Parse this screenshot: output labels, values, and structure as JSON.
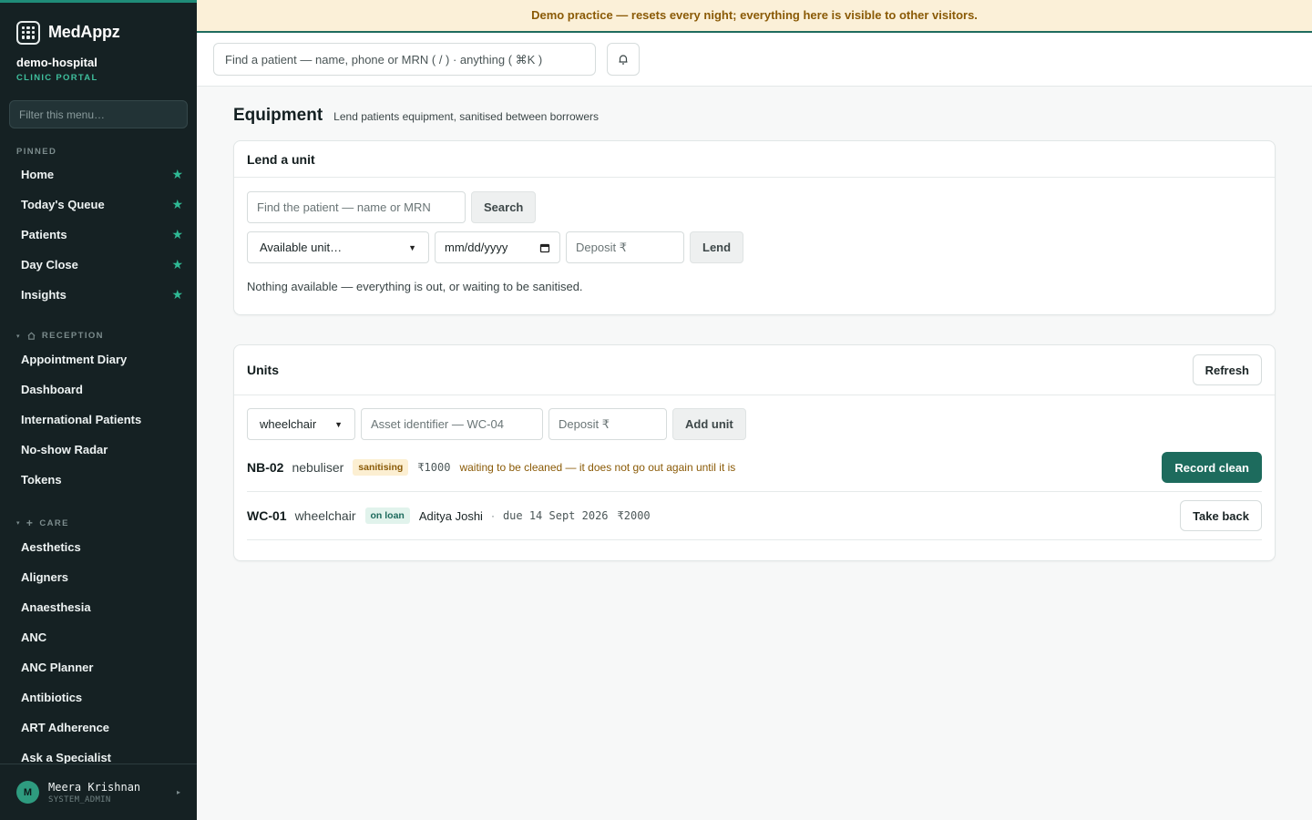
{
  "brand": {
    "name": "MedAppz"
  },
  "org": {
    "name": "demo-hospital",
    "subtitle": "CLINIC PORTAL"
  },
  "sidebar": {
    "filter_placeholder": "Filter this menu…",
    "pinned_label": "PINNED",
    "pinned": [
      {
        "label": "Home"
      },
      {
        "label": "Today's Queue"
      },
      {
        "label": "Patients"
      },
      {
        "label": "Day Close"
      },
      {
        "label": "Insights"
      }
    ],
    "reception_label": "RECEPTION",
    "reception": [
      {
        "label": "Appointment Diary"
      },
      {
        "label": "Dashboard"
      },
      {
        "label": "International Patients"
      },
      {
        "label": "No-show Radar"
      },
      {
        "label": "Tokens"
      }
    ],
    "care_label": "CARE",
    "care": [
      {
        "label": "Aesthetics"
      },
      {
        "label": "Aligners"
      },
      {
        "label": "Anaesthesia"
      },
      {
        "label": "ANC"
      },
      {
        "label": "ANC Planner"
      },
      {
        "label": "Antibiotics"
      },
      {
        "label": "ART Adherence"
      },
      {
        "label": "Ask a Specialist"
      }
    ]
  },
  "user": {
    "initial": "M",
    "name": "Meera Krishnan",
    "role": "SYSTEM_ADMIN"
  },
  "banner": {
    "text": "Demo practice — resets every night; everything here is visible to other visitors."
  },
  "topbar": {
    "search_placeholder": "Find a patient — name, phone or MRN ( / ) · anything ( ⌘K )"
  },
  "page": {
    "title": "Equipment",
    "subtitle": "Lend patients equipment, sanitised between borrowers"
  },
  "lend": {
    "title": "Lend a unit",
    "patient_placeholder": "Find the patient — name or MRN",
    "search_label": "Search",
    "unit_select": "Available unit…",
    "date_placeholder": "mm/dd/yyyy",
    "deposit_placeholder": "Deposit ₹",
    "lend_label": "Lend",
    "empty_note": "Nothing available — everything is out, or waiting to be sanitised."
  },
  "units": {
    "title": "Units",
    "refresh_label": "Refresh",
    "type_select": "wheelchair",
    "asset_placeholder": "Asset identifier — WC-04",
    "deposit_placeholder": "Deposit ₹",
    "add_label": "Add unit",
    "rows": [
      {
        "id": "NB-02",
        "type": "nebuliser",
        "status": "sanitising",
        "deposit": "₹1000",
        "note": "waiting to be cleaned — it does not go out again until it is",
        "action": "Record clean"
      },
      {
        "id": "WC-01",
        "type": "wheelchair",
        "status": "on loan",
        "patient": "Aditya Joshi",
        "separator": "·",
        "due": "due 14 Sept 2026",
        "deposit": "₹2000",
        "action": "Take back"
      }
    ]
  },
  "colors": {
    "accent": "#1d6b5d",
    "sidebar_bg": "#152123",
    "warn": "#8a5a06",
    "pin_star": "#2fb995"
  }
}
